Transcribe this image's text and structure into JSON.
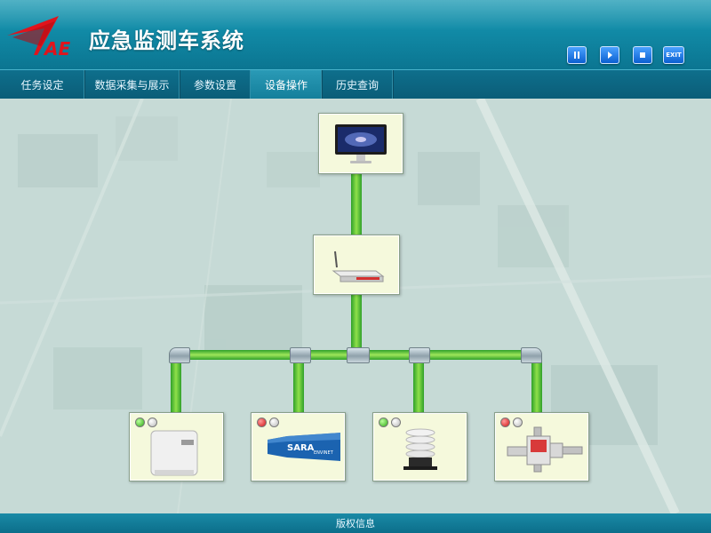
{
  "header": {
    "logo_text": "AE",
    "title": "应急监测车系统",
    "controls": [
      {
        "name": "pause-button",
        "icon": "pause-icon",
        "label": ""
      },
      {
        "name": "play-button",
        "icon": "play-icon",
        "label": ""
      },
      {
        "name": "stop-button",
        "icon": "stop-icon",
        "label": ""
      },
      {
        "name": "exit-button",
        "icon": "exit-icon",
        "label": "EXIT"
      }
    ]
  },
  "nav": {
    "tabs": [
      {
        "label": "任务设定",
        "active": false
      },
      {
        "label": "数据采集与展示",
        "active": false
      },
      {
        "label": "参数设置",
        "active": false
      },
      {
        "label": "设备操作",
        "active": true
      },
      {
        "label": "历史查询",
        "active": false
      }
    ]
  },
  "devices": {
    "monitor": {
      "icon": "computer-monitor-icon"
    },
    "router": {
      "icon": "router-icon"
    },
    "nodes": [
      {
        "icon": "analyzer-box-icon",
        "status": [
          "green",
          "gray"
        ]
      },
      {
        "icon": "sara-sensor-icon",
        "label": "SARA",
        "sublabel": "ENVINET",
        "status": [
          "red",
          "gray"
        ]
      },
      {
        "icon": "weather-shield-icon",
        "status": [
          "green",
          "gray"
        ]
      },
      {
        "icon": "detector-probe-icon",
        "status": [
          "red",
          "gray"
        ]
      }
    ]
  },
  "footer": {
    "text": "版权信息"
  },
  "colors": {
    "header": "#118aa6",
    "nav": "#0e6f8c",
    "pipe": "#2fa02a",
    "box": "#f5f9dc"
  }
}
